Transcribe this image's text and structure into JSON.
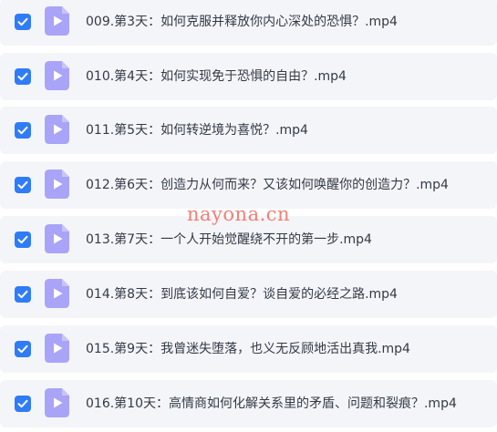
{
  "files": [
    {
      "name": "009.第3天：如何克服并释放你内心深处的恐惧？.mp4",
      "checked": true,
      "icon": "video-file-icon"
    },
    {
      "name": "010.第4天：如何实现免于恐惧的自由？.mp4",
      "checked": true,
      "icon": "video-file-icon"
    },
    {
      "name": "011.第5天：如何转逆境为喜悦？.mp4",
      "checked": true,
      "icon": "video-file-icon"
    },
    {
      "name": "012.第6天：创造力从何而来？又该如何唤醒你的创造力？.mp4",
      "checked": true,
      "icon": "video-file-icon"
    },
    {
      "name": "013.第7天：一个人开始觉醒绕不开的第一步.mp4",
      "checked": true,
      "icon": "video-file-icon"
    },
    {
      "name": "014.第8天：到底该如何自爱？谈自爱的必经之路.mp4",
      "checked": true,
      "icon": "video-file-icon"
    },
    {
      "name": "015.第9天：我曾迷失堕落，也义无反顾地活出真我.mp4",
      "checked": true,
      "icon": "video-file-icon"
    },
    {
      "name": "016.第10天：高情商如何化解关系里的矛盾、问题和裂痕？.mp4",
      "checked": true,
      "icon": "video-file-icon"
    }
  ],
  "watermark": "nayona.cn",
  "colors": {
    "row_background": "#f4f5f9",
    "checkbox": "#2f7cf6",
    "icon_background": "#a9a4f7",
    "icon_play": "#ffffff",
    "text": "#333a45",
    "watermark": "#f06a5c"
  }
}
